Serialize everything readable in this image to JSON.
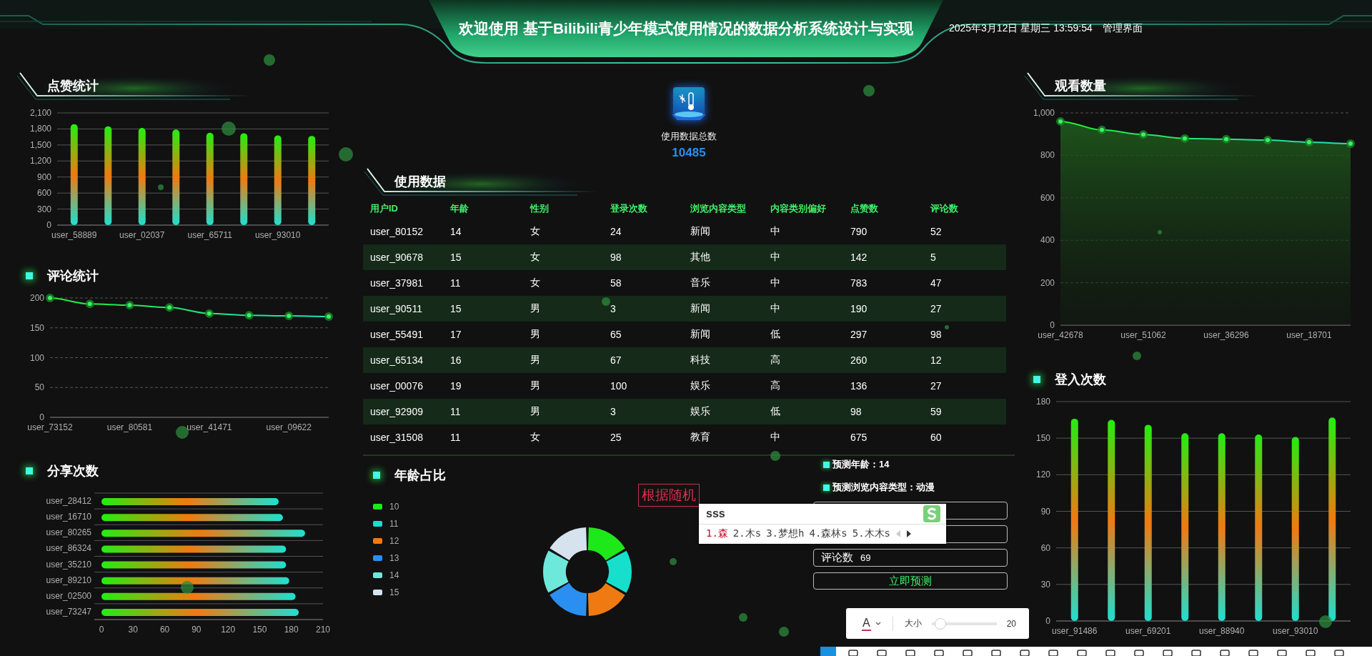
{
  "header": {
    "title": "欢迎使用 基于Bilibili青少年模式使用情况的数据分析系统设计与实现",
    "datetime": "2025年3月12日 星期三 13:59:54",
    "admin_link": "管理界面"
  },
  "left_panels": [
    {
      "title": "点赞统计",
      "kind": "banner",
      "chart_data": {
        "type": "bar",
        "ylim": [
          0,
          2100
        ],
        "yticks": [
          0,
          300,
          600,
          900,
          {
            "value": 1200,
            "label": "1,200"
          },
          {
            "value": 1500,
            "label": "1,500"
          },
          {
            "value": 1800,
            "label": "1,800"
          },
          {
            "value": 2100,
            "label": "2,100"
          }
        ],
        "grid": true,
        "categories": [
          "user_58889",
          null,
          "user_02037",
          null,
          "user_65711",
          null,
          "user_93010",
          null
        ],
        "values": [
          1890,
          1850,
          1820,
          1790,
          1730,
          1720,
          1680,
          1670
        ]
      }
    },
    {
      "title": "评论统计",
      "kind": "square",
      "chart_data": {
        "type": "line",
        "ylim": [
          0,
          200
        ],
        "yticks": [
          0,
          50,
          100,
          150,
          200
        ],
        "grid": true,
        "marker": "circle",
        "categories": [
          "user_73152",
          null,
          "user_80581",
          null,
          "user_41471",
          null,
          "user_09622",
          null
        ],
        "values": [
          200,
          190,
          188,
          184,
          174,
          171,
          170,
          169
        ]
      }
    },
    {
      "title": "分享次数",
      "kind": "square",
      "chart_data": {
        "type": "bar",
        "orientation": "horizontal",
        "categories": [
          "user_28412",
          "user_16710",
          "user_80265",
          "user_86324",
          "user_35210",
          "user_89210",
          "user_02500",
          "user_73247"
        ],
        "xlim": [
          0,
          210
        ],
        "xticks": [
          0,
          30,
          60,
          90,
          120,
          150,
          180,
          210
        ],
        "values": [
          168,
          172,
          193,
          175,
          175,
          178,
          184,
          187
        ]
      }
    }
  ],
  "summary": {
    "label": "使用数据总数",
    "value": "10485"
  },
  "table": {
    "title": "使用数据",
    "kind": "banner",
    "columns": [
      "用户ID",
      "年龄",
      "性别",
      "登录次数",
      "浏览内容类型",
      "内容类别偏好",
      "点赞数",
      "评论数"
    ],
    "rows": [
      [
        "user_80152",
        "14",
        "女",
        "24",
        "新闻",
        "中",
        "790",
        "52"
      ],
      [
        "user_90678",
        "15",
        "女",
        "98",
        "其他",
        "中",
        "142",
        "5"
      ],
      [
        "user_37981",
        "11",
        "女",
        "58",
        "音乐",
        "中",
        "783",
        "47"
      ],
      [
        "user_90511",
        "15",
        "男",
        "3",
        "新闻",
        "中",
        "190",
        "27"
      ],
      [
        "user_55491",
        "17",
        "男",
        "65",
        "新闻",
        "低",
        "297",
        "98"
      ],
      [
        "user_65134",
        "16",
        "男",
        "67",
        "科技",
        "高",
        "260",
        "12"
      ],
      [
        "user_00076",
        "19",
        "男",
        "100",
        "娱乐",
        "高",
        "136",
        "27"
      ],
      [
        "user_92909",
        "11",
        "男",
        "3",
        "娱乐",
        "低",
        "98",
        "59"
      ],
      [
        "user_31508",
        "11",
        "女",
        "25",
        "教育",
        "中",
        "675",
        "60"
      ]
    ]
  },
  "age_panel": {
    "title": "年龄占比",
    "kind": "square",
    "chart_data": {
      "type": "donut",
      "categories": [
        "10",
        "11",
        "12",
        "13",
        "14",
        "15"
      ],
      "values": [
        16.7,
        16.7,
        16.6,
        16.7,
        16.7,
        16.6
      ],
      "colors": [
        "#1ee81a",
        "#16e0cc",
        "#f07a12",
        "#2a8ff0",
        "#6fe8dc",
        "#d6e2ee"
      ]
    }
  },
  "prediction": {
    "results": [
      "预测年龄：14",
      "预测浏览内容类型：动漫"
    ],
    "fields": [
      {
        "label": "评论数",
        "value": "69"
      }
    ],
    "submit": "立即预测"
  },
  "annotation": {
    "text": "根据随机"
  },
  "ime": {
    "input": "sss",
    "candidates": [
      {
        "text": "1.森",
        "selected": true
      },
      {
        "text": "2.木s",
        "selected": false
      },
      {
        "text": "3.梦想h",
        "selected": false
      },
      {
        "text": "4.森林s",
        "selected": false
      },
      {
        "text": "5.木木s",
        "selected": false
      }
    ]
  },
  "draw_toolbar": {
    "color_button": "A",
    "size_label": "大小",
    "size_slider": {
      "level": 0.05
    },
    "size_value": "20"
  },
  "right_panels": [
    {
      "title": "观看数量",
      "kind": "banner",
      "chart_data": {
        "type": "line",
        "grid": true,
        "marker": "circle",
        "ylim": [
          0,
          1000
        ],
        "yticks": [
          0,
          200,
          400,
          600,
          800,
          {
            "value": 1000,
            "label": "1,000"
          }
        ],
        "categories": [
          "user_42678",
          null,
          "user_51062",
          null,
          "user_36296",
          null,
          "user_18701",
          null
        ],
        "values": [
          960,
          920,
          898,
          880,
          876,
          872,
          862,
          855
        ]
      }
    },
    {
      "title": "登入次数",
      "kind": "square",
      "chart_data": {
        "type": "bar",
        "ylim": [
          0,
          180
        ],
        "yticks": [
          0,
          30,
          60,
          90,
          120,
          150,
          180
        ],
        "grid": true,
        "categories": [
          "user_91486",
          null,
          "user_69201",
          null,
          "user_88940",
          null,
          "user_93010",
          null
        ],
        "values": [
          166,
          165,
          161,
          154,
          154,
          153,
          151,
          167
        ]
      }
    }
  ]
}
